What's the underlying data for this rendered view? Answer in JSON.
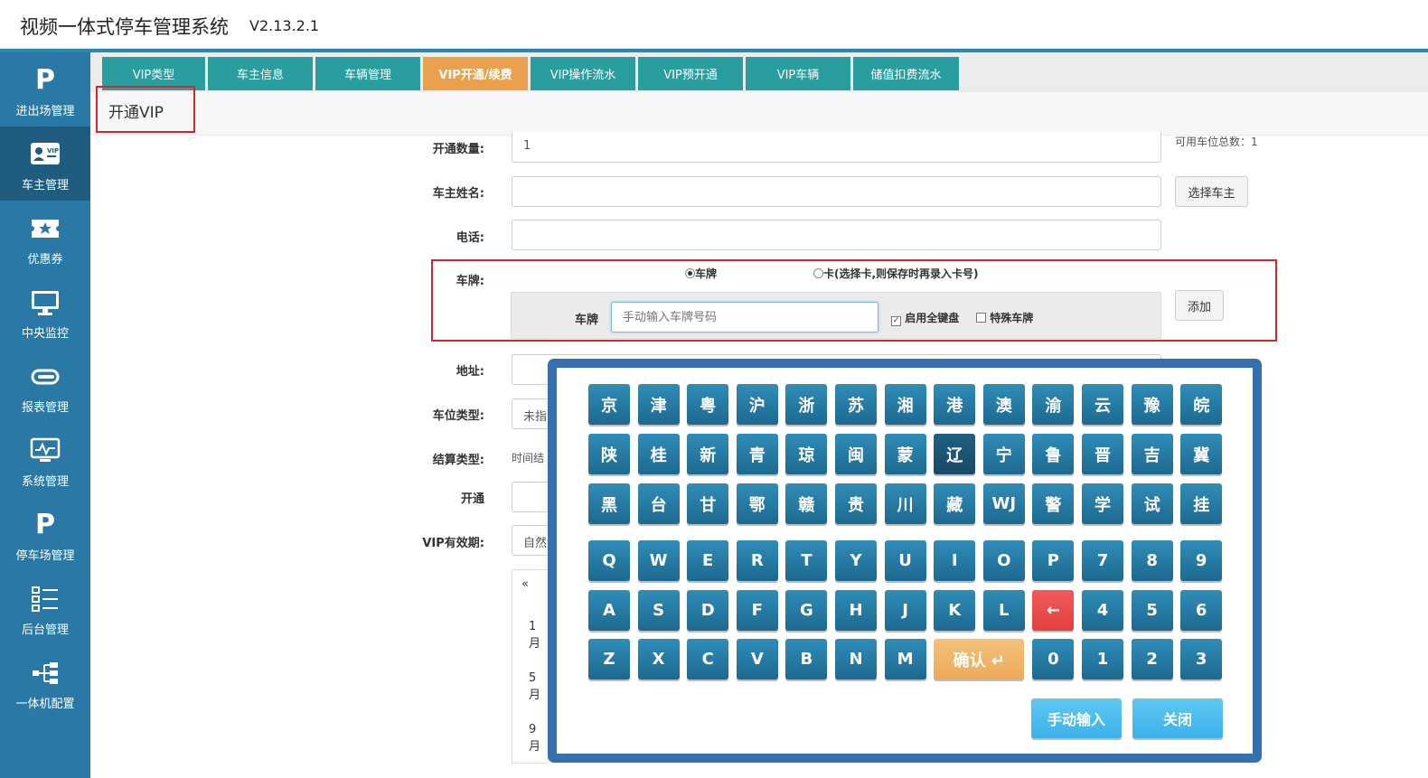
{
  "app": {
    "title": "视频一体式停车管理系统",
    "version": "V2.13.2.1"
  },
  "sidebar": {
    "items": [
      {
        "label": "进出场管理",
        "icon": "parking-icon"
      },
      {
        "label": "车主管理",
        "icon": "vip-card-icon"
      },
      {
        "label": "优惠券",
        "icon": "ticket-icon"
      },
      {
        "label": "中央监控",
        "icon": "monitor-icon"
      },
      {
        "label": "报表管理",
        "icon": "paperclip-icon"
      },
      {
        "label": "系统管理",
        "icon": "screen-settings-icon"
      },
      {
        "label": "停车场管理",
        "icon": "parking-icon"
      },
      {
        "label": "后台管理",
        "icon": "list-icon"
      },
      {
        "label": "一体机配置",
        "icon": "hierarchy-icon"
      }
    ],
    "active_index": 1
  },
  "tabs": [
    {
      "label": "VIP类型"
    },
    {
      "label": "车主信息"
    },
    {
      "label": "车辆管理"
    },
    {
      "label": "VIP开通/续费"
    },
    {
      "label": "VIP操作流水"
    },
    {
      "label": "VIP预开通"
    },
    {
      "label": "VIP车辆"
    },
    {
      "label": "储值扣费流水"
    }
  ],
  "active_tab": 3,
  "page_title": "开通VIP",
  "form": {
    "quantity_label": "开通数量:",
    "quantity_value": "1",
    "available_spaces": "可用车位总数：1",
    "owner_label": "车主姓名:",
    "choose_owner": "选择车主",
    "phone_label": "电话:",
    "plate_label": "车牌:",
    "plate_option": "车牌",
    "card_option": "卡(选择卡,则保存时再录入卡号)",
    "plate_inner_label": "车牌",
    "plate_placeholder": "手动输入车牌号码",
    "full_keyboard": "启用全键盘",
    "special_plate": "特殊车牌",
    "add_button": "添加",
    "address_label": "地址:",
    "space_type_label": "车位类型:",
    "space_type_value": "未指",
    "settle_type_label": "结算类型:",
    "settle_type_value": "时间结",
    "open_label": "开通",
    "validity_label": "VIP有效期:",
    "validity_value": "自然"
  },
  "calendar": {
    "prev": "«",
    "months": [
      "1月",
      "5月",
      "9月"
    ]
  },
  "keyboard": {
    "provinces": [
      [
        "京",
        "津",
        "粤",
        "沪",
        "浙",
        "苏",
        "湘",
        "港",
        "澳",
        "渝",
        "云",
        "豫",
        "皖"
      ],
      [
        "陕",
        "桂",
        "新",
        "青",
        "琼",
        "闽",
        "蒙",
        "辽",
        "宁",
        "鲁",
        "晋",
        "吉",
        "冀"
      ],
      [
        "黑",
        "台",
        "甘",
        "鄂",
        "赣",
        "贵",
        "川",
        "藏",
        "WJ",
        "警",
        "学",
        "试",
        "挂"
      ]
    ],
    "row1": [
      "Q",
      "W",
      "E",
      "R",
      "T",
      "Y",
      "U",
      "I",
      "O",
      "P",
      "7",
      "8",
      "9"
    ],
    "row2": [
      "A",
      "S",
      "D",
      "F",
      "G",
      "H",
      "J",
      "K",
      "L",
      "←",
      "4",
      "5",
      "6"
    ],
    "row3_left": [
      "Z",
      "X",
      "C",
      "V",
      "B",
      "N",
      "M"
    ],
    "confirm": "确认 ↵",
    "row3_right": [
      "0",
      "1",
      "2",
      "3"
    ],
    "manual_input": "手动输入",
    "close": "关闭"
  }
}
